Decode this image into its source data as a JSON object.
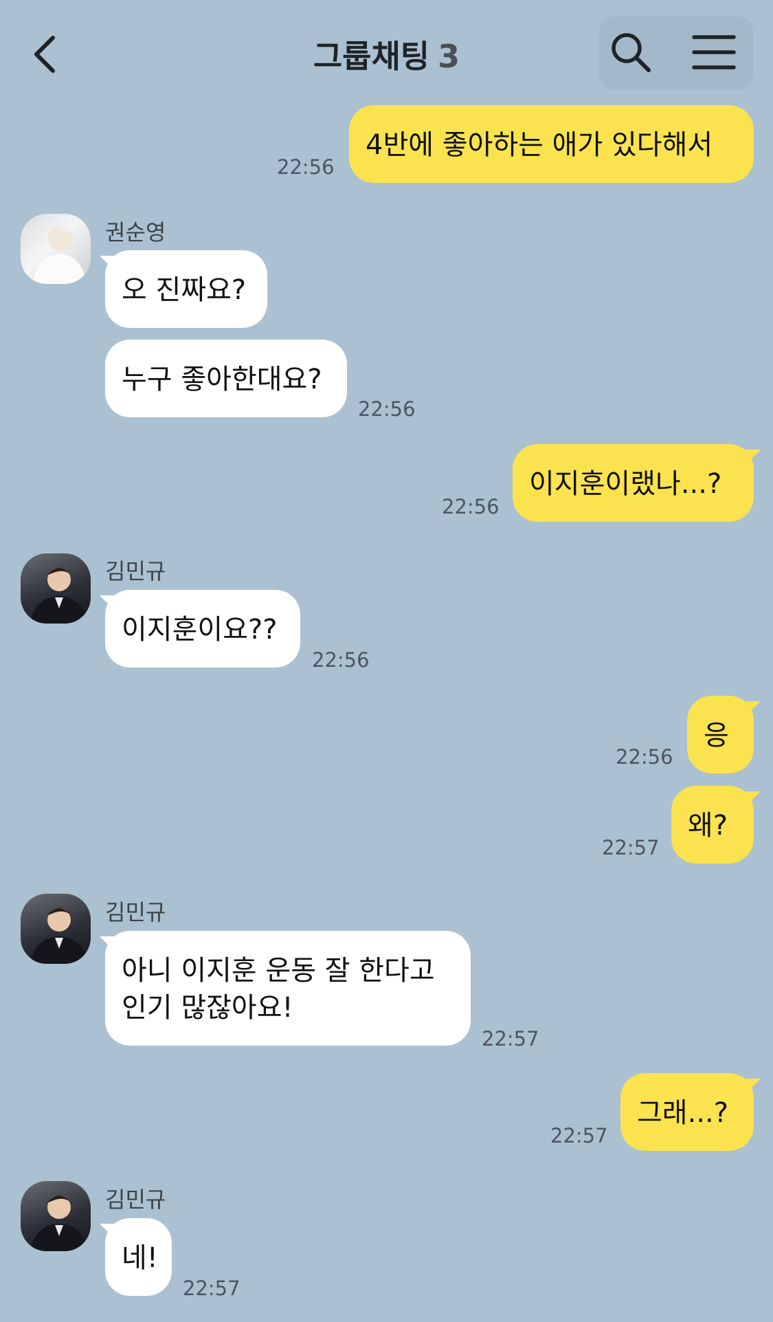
{
  "header": {
    "title": "그룹채팅",
    "member_count": "3"
  },
  "messages": [
    {
      "id": "m1",
      "side": "out",
      "text": "4반에 좋아하는 애가 있다해서",
      "time": "22:56"
    },
    {
      "id": "m2",
      "side": "in",
      "sender": "권순영",
      "text": "오 진짜요?"
    },
    {
      "id": "m3",
      "side": "in",
      "text": "누구 좋아한대요?",
      "time": "22:56"
    },
    {
      "id": "m4",
      "side": "out",
      "text": "이지훈이랬나...?",
      "time": "22:56"
    },
    {
      "id": "m5",
      "side": "in",
      "sender": "김민규",
      "text": "이지훈이요??",
      "time": "22:56"
    },
    {
      "id": "m6",
      "side": "out",
      "text": "응",
      "time": "22:56"
    },
    {
      "id": "m7",
      "side": "out",
      "text": "왜?",
      "time": "22:57"
    },
    {
      "id": "m8",
      "side": "in",
      "sender": "김민규",
      "text": "아니 이지훈 운동 잘 한다고\n인기 많잖아요!",
      "time": "22:57"
    },
    {
      "id": "m9",
      "side": "out",
      "text": "그래...?",
      "time": "22:57"
    },
    {
      "id": "m10",
      "side": "in",
      "sender": "김민규",
      "text": "네!",
      "time": "22:57"
    }
  ],
  "colors": {
    "background": "#abc1d1",
    "outgoing_bubble": "#fae34e",
    "incoming_bubble": "#ffffff"
  },
  "icons": [
    "back-chevron-icon",
    "search-icon",
    "menu-icon"
  ]
}
